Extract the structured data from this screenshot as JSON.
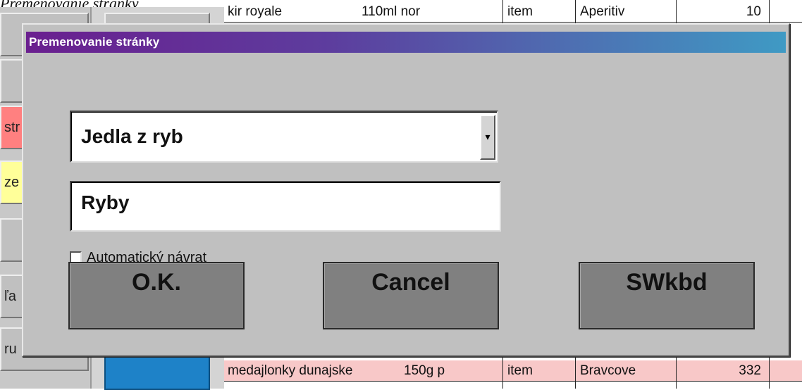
{
  "background": {
    "window_title": "Premenovanie stránky",
    "left_buttons": [
      "",
      "",
      "str",
      "ze",
      "",
      "ľa",
      "ru"
    ],
    "table_rows": [
      {
        "name": "kir royale",
        "size": "110ml nor",
        "kind": "item",
        "category": "Aperitiv",
        "value": "10",
        "pink": false
      },
      {
        "name": "medajlonky dunajske",
        "size": "150g p",
        "kind": "item",
        "category": "Bravcove",
        "value": "332",
        "pink": true
      }
    ]
  },
  "dialog": {
    "title": "Premenovanie stránky",
    "combo": {
      "value": "Jedla z ryb",
      "arrow": "▾"
    },
    "name_input": {
      "value": "Ryby"
    },
    "auto_return": {
      "label": "Automatický návrat",
      "checked": false
    },
    "buttons": {
      "ok": "O.K.",
      "cancel": "Cancel",
      "swkbd": "SWkbd"
    }
  },
  "colors": {
    "titlebar_start": "#6a1f8f",
    "titlebar_end": "#3f9ac4",
    "dialog_face": "#c0c0c0",
    "button_face": "#808080",
    "blue_button": "#1e82c8",
    "pink_row": "#f8c8c8",
    "yellow_button": "#ffff99",
    "red_button": "#ff8080"
  }
}
